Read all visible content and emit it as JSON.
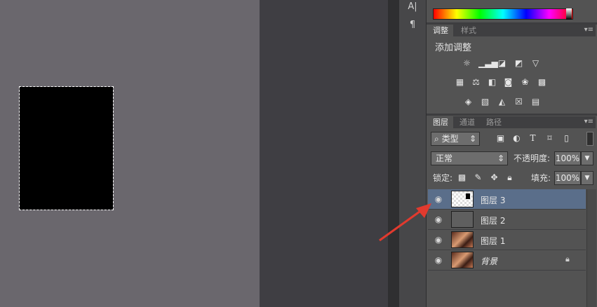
{
  "adjustments_panel": {
    "tab_adjust": "调整",
    "tab_styles": "样式",
    "add_label": "添加调整"
  },
  "layers_panel": {
    "tab_layers": "图层",
    "tab_channels": "通道",
    "tab_paths": "路径",
    "filter_kind": "类型",
    "blend_mode": "正常",
    "opacity_label": "不透明度:",
    "opacity_value": "100%",
    "lock_label": "锁定:",
    "fill_label": "填充:",
    "fill_value": "100%",
    "layers": [
      {
        "name": "图层 3",
        "selected": true
      },
      {
        "name": "图层 2",
        "selected": false
      },
      {
        "name": "图层 1",
        "selected": false
      },
      {
        "name": "背景",
        "selected": false,
        "locked": true
      }
    ]
  },
  "toolstrip": {
    "char_tool": "A|",
    "para_tool": "¶"
  },
  "colors": {
    "canvas_gray": "#6a676d",
    "selection_fill": "#000000",
    "selected_layer": "#5a6e8a",
    "arrow": "#e23a2e"
  }
}
